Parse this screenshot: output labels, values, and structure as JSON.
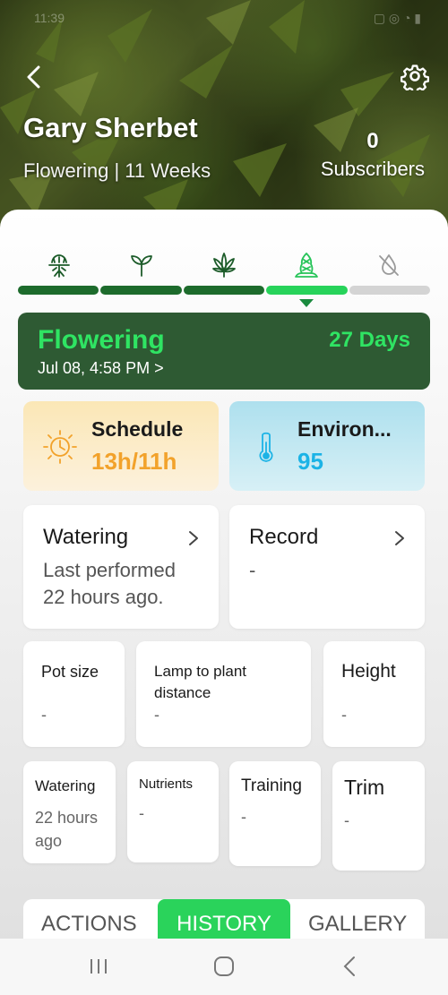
{
  "status_bar": {
    "time": "11:39"
  },
  "header": {
    "user_name": "Gary Sherbet",
    "stage_line": "Flowering | 11 Weeks",
    "subscribers_count": "0",
    "subscribers_label": "Subscribers"
  },
  "stages": {
    "icons": [
      "germination-icon",
      "seedling-icon",
      "vegetative-icon",
      "flowering-icon",
      "drying-icon"
    ],
    "current_index": 3
  },
  "current_stage": {
    "name": "Flowering",
    "days": "27 Days",
    "start_date": "Jul 08, 4:58 PM >"
  },
  "schedule": {
    "title": "Schedule",
    "value": "13h/11h"
  },
  "environment": {
    "title": "Environ...",
    "value": "95"
  },
  "watering_card": {
    "title": "Watering",
    "line1": "Last performed",
    "line2": "22 hours ago."
  },
  "record_card": {
    "title": "Record",
    "value": "-"
  },
  "metrics_row1": {
    "pot_size": {
      "label": "Pot size",
      "value": "-"
    },
    "lamp_distance": {
      "label": "Lamp to plant distance",
      "value": "-"
    },
    "height": {
      "label": "Height",
      "value": "-"
    }
  },
  "metrics_row2": {
    "watering": {
      "label": "Watering",
      "value": "22 hours ago"
    },
    "nutrients": {
      "label": "Nutrients",
      "value": "-"
    },
    "training": {
      "label": "Training",
      "value": "-"
    },
    "trim": {
      "label": "Trim",
      "value": "-"
    }
  },
  "tabs": {
    "actions": "ACTIONS",
    "history": "HISTORY",
    "gallery": "GALLERY",
    "active": "HISTORY"
  },
  "colors": {
    "accent_green": "#2ad35b",
    "dark_green": "#2e5a33",
    "schedule_orange": "#f2a22b",
    "env_blue": "#1bb3e6"
  }
}
